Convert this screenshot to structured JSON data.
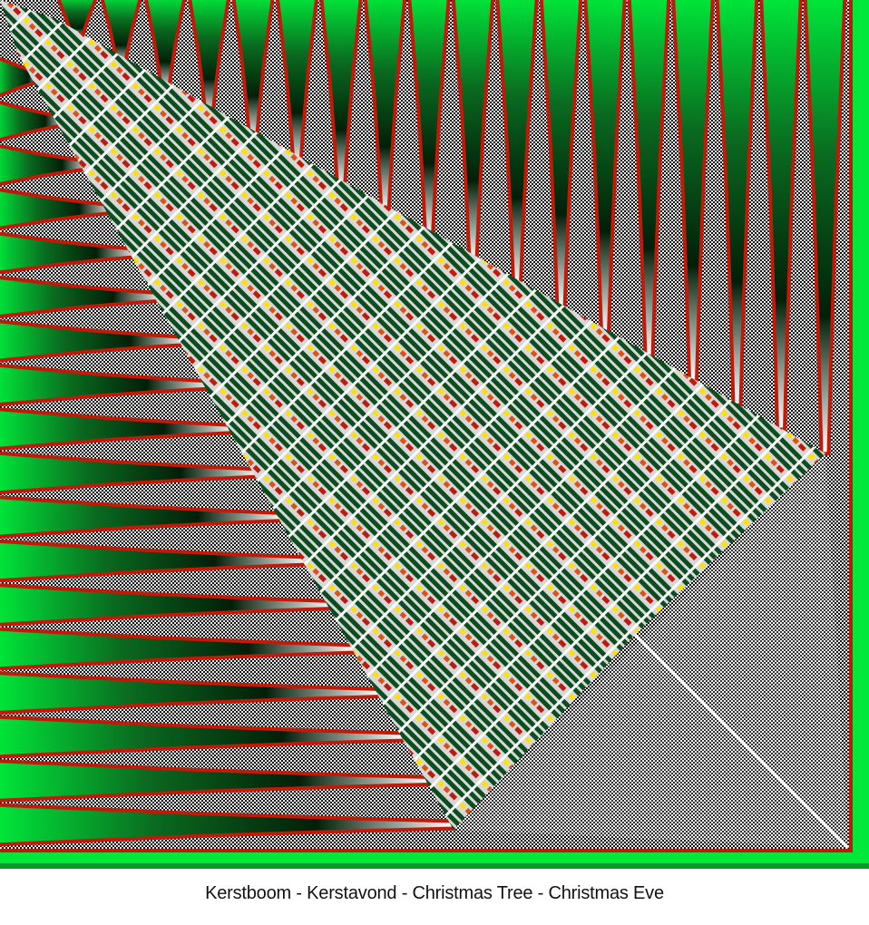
{
  "artwork": {
    "caption": "Kerstboom - Kerstavond - Christmas Tree - Christmas Eve",
    "colors": {
      "bright_green": "#00e83a",
      "dark_green": "#0b4d1e",
      "deep_green": "#022a0c",
      "red": "#c01a0a",
      "yellow": "#ffe000",
      "checker_dark": "#111111",
      "checker_light": "#e8e8e8",
      "white": "#ffffff"
    }
  }
}
